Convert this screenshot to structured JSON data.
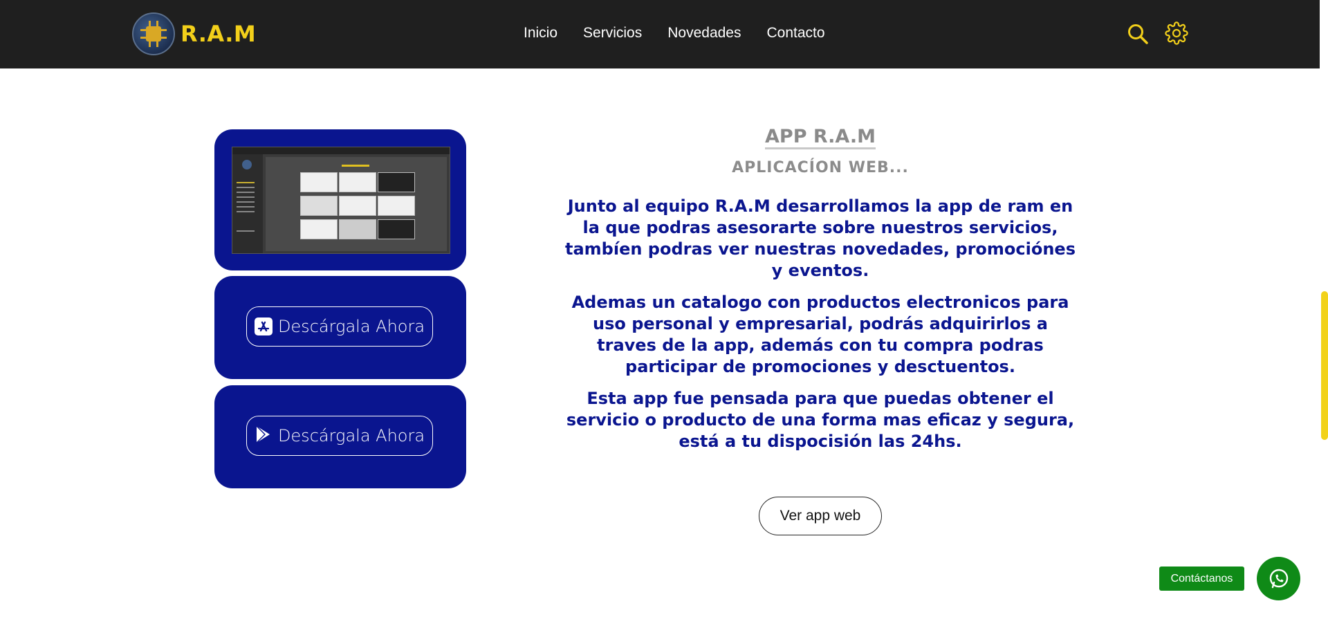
{
  "brand": {
    "name": "R.A.M",
    "accent": "#f2cf1a",
    "primary": "#0a158f",
    "header_bg": "#1f1f1f"
  },
  "nav": {
    "items": [
      {
        "label": "Inicio"
      },
      {
        "label": "Servicios"
      },
      {
        "label": "Novedades"
      },
      {
        "label": "Contacto"
      }
    ]
  },
  "header_icons": {
    "search": "search-icon",
    "settings": "gear-icon"
  },
  "left": {
    "preview_alt": "app-screenshot-preview",
    "preview_title": "NOVEDADES",
    "download_appstore": {
      "label": "Descárgala Ahora",
      "icon": "app-store-icon"
    },
    "download_playstore": {
      "label": "Descárgala Ahora",
      "icon": "google-play-icon"
    }
  },
  "main": {
    "title": "APP R.A.M",
    "subtitle": "APLICACÍON WEB...",
    "paragraphs": [
      "Junto al equipo R.A.M desarrollamos la app de ram en la que podras asesorarte sobre nuestros servicios, tambíen podras ver nuestras novedades, promociónes y eventos.",
      "Ademas un catalogo con productos electronicos para uso personal y empresarial, podrás adquirirlos a traves de la app, además con tu compra podras participar de promociones y desctuentos.",
      "Esta app fue pensada para que puedas obtener el servicio o producto de una forma mas eficaz y segura, está a tu dispocisión las 24hs."
    ],
    "cta_label": "Ver app web"
  },
  "contact": {
    "label": "Contáctanos",
    "icon": "whatsapp-icon",
    "color": "#0f8a17"
  }
}
